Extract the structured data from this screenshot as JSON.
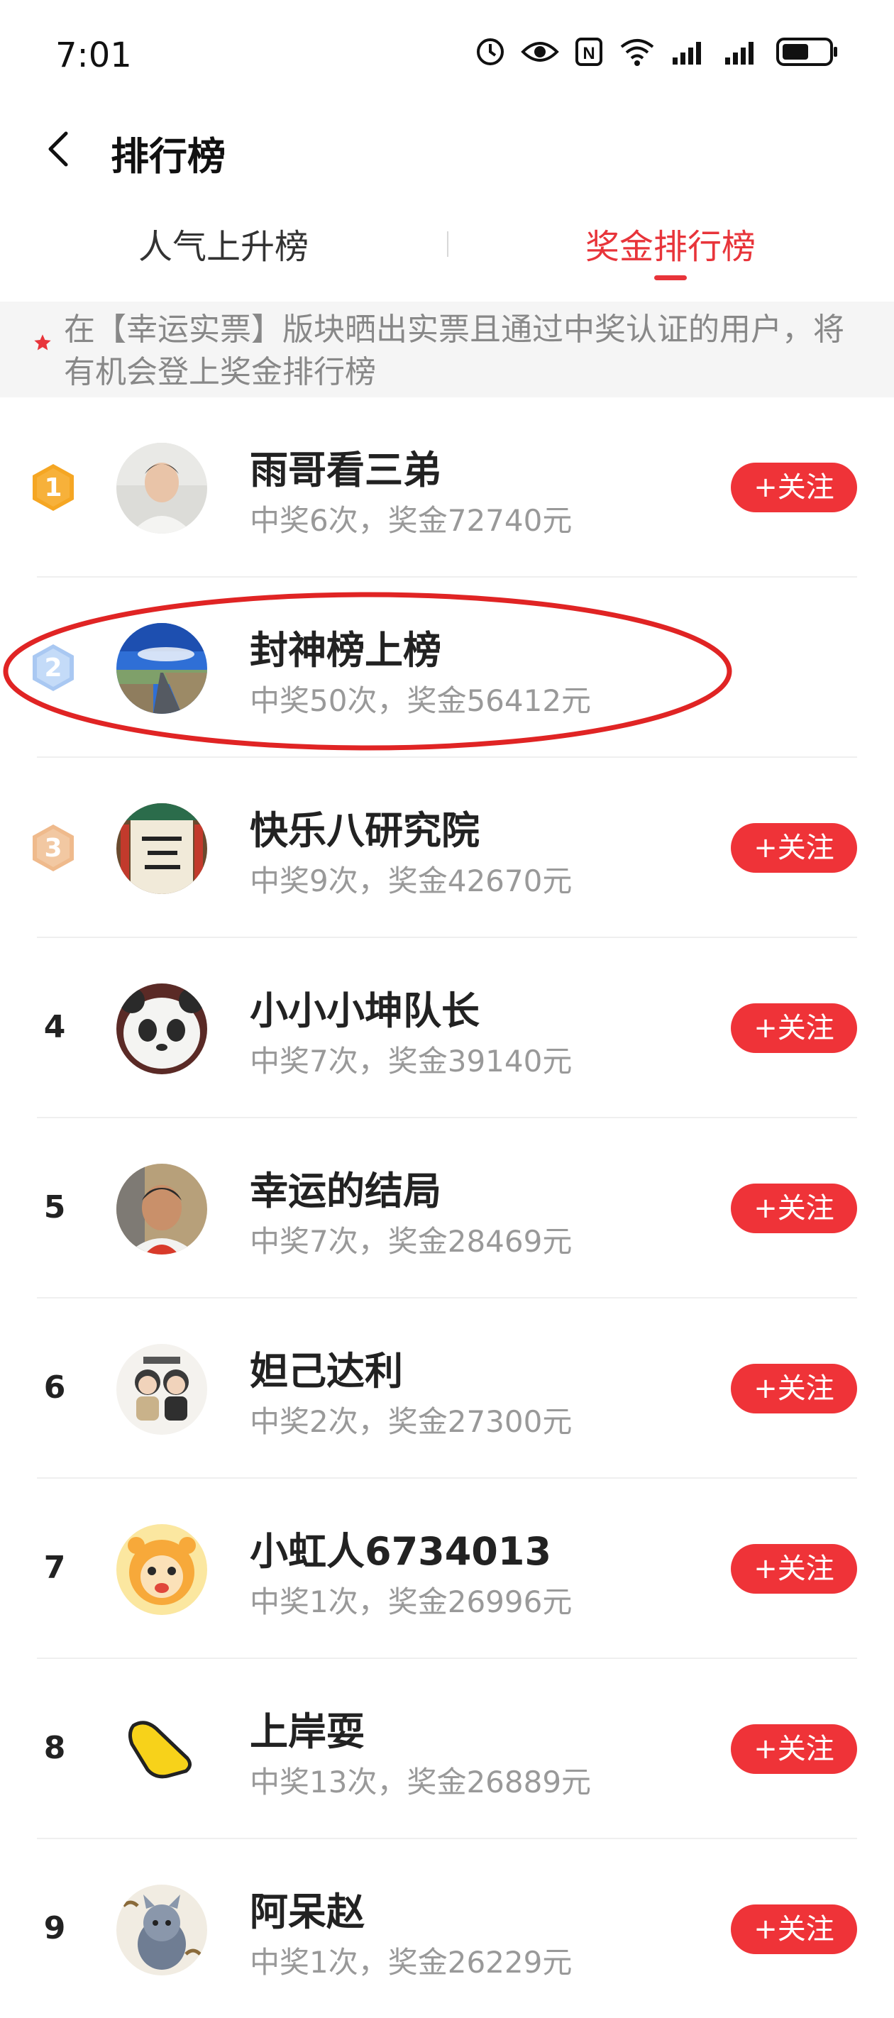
{
  "status": {
    "time": "7:01",
    "nfc_label": "N"
  },
  "header": {
    "title": "排行榜"
  },
  "tabs": [
    {
      "label": "人气上升榜",
      "active": false
    },
    {
      "label": "奖金排行榜",
      "active": true
    }
  ],
  "notice": {
    "text": "在【幸运实票】版块晒出实票且通过中奖认证的用户，将有机会登上奖金排行榜"
  },
  "colors": {
    "accent": "#e8343a",
    "gold": "#f5a623",
    "silver": "#a9c8f2",
    "bronze": "#efba8c"
  },
  "rankings": [
    {
      "rank": "1",
      "name": "雨哥看三弟",
      "stats": "中奖6次，奖金72740元",
      "follow_label": "+关注",
      "medal": "gold",
      "avatar": "avatar-man"
    },
    {
      "rank": "2",
      "name": "封神榜上榜",
      "stats": "中奖50次，奖金56412元",
      "follow_label": "",
      "medal": "silver",
      "avatar": "avatar-road"
    },
    {
      "rank": "3",
      "name": "快乐八研究院",
      "stats": "中奖9次，奖金42670元",
      "follow_label": "+关注",
      "medal": "bronze",
      "avatar": "avatar-calligraphy"
    },
    {
      "rank": "4",
      "name": "小小小坤队长",
      "stats": "中奖7次，奖金39140元",
      "follow_label": "+关注",
      "medal": "",
      "avatar": "avatar-panda"
    },
    {
      "rank": "5",
      "name": "幸运的结局",
      "stats": "中奖7次，奖金28469元",
      "follow_label": "+关注",
      "medal": "",
      "avatar": "avatar-man-red"
    },
    {
      "rank": "6",
      "name": "妲己达利",
      "stats": "中奖2次，奖金27300元",
      "follow_label": "+关注",
      "medal": "",
      "avatar": "avatar-couple"
    },
    {
      "rank": "7",
      "name": "小虹人6734013",
      "stats": "中奖1次，奖金26996元",
      "follow_label": "+关注",
      "medal": "",
      "avatar": "avatar-tiger"
    },
    {
      "rank": "8",
      "name": "上岸耍",
      "stats": "中奖13次，奖金26889元",
      "follow_label": "+关注",
      "medal": "",
      "avatar": "avatar-hand"
    },
    {
      "rank": "9",
      "name": "阿呆赵",
      "stats": "中奖1次，奖金26229元",
      "follow_label": "+关注",
      "medal": "",
      "avatar": "avatar-cat"
    }
  ]
}
